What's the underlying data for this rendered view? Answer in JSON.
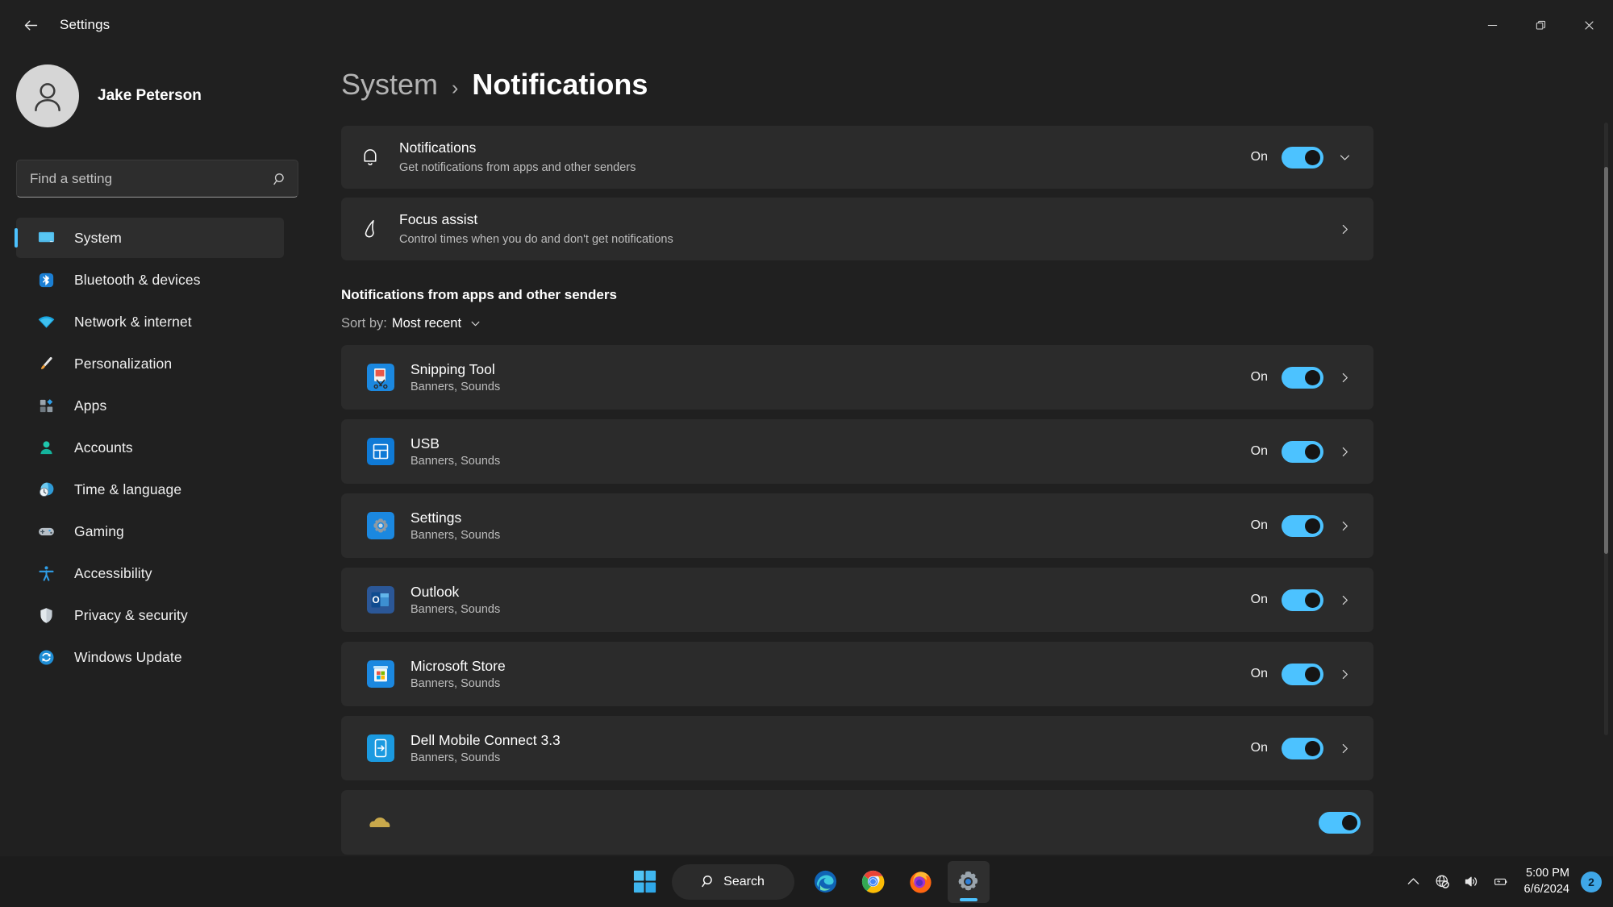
{
  "window": {
    "title": "Settings",
    "back_icon": "back-arrow-icon",
    "minimize_label": "Minimize",
    "restore_label": "Restore",
    "close_label": "Close"
  },
  "sidebar": {
    "profile_name": "Jake Peterson",
    "avatar_icon": "person-avatar-icon",
    "search": {
      "placeholder": "Find a setting",
      "value": "",
      "icon": "search-icon"
    },
    "items": [
      {
        "label": "System",
        "icon": "monitor-icon",
        "active": true
      },
      {
        "label": "Bluetooth & devices",
        "icon": "bluetooth-icon",
        "active": false
      },
      {
        "label": "Network & internet",
        "icon": "wifi-icon",
        "active": false
      },
      {
        "label": "Personalization",
        "icon": "paintbrush-icon",
        "active": false
      },
      {
        "label": "Apps",
        "icon": "apps-grid-icon",
        "active": false
      },
      {
        "label": "Accounts",
        "icon": "person-icon",
        "active": false
      },
      {
        "label": "Time & language",
        "icon": "clock-globe-icon",
        "active": false
      },
      {
        "label": "Gaming",
        "icon": "gamepad-icon",
        "active": false
      },
      {
        "label": "Accessibility",
        "icon": "accessibility-person-icon",
        "active": false
      },
      {
        "label": "Privacy & security",
        "icon": "shield-icon",
        "active": false
      },
      {
        "label": "Windows Update",
        "icon": "update-refresh-icon",
        "active": false
      }
    ]
  },
  "main": {
    "breadcrumb": {
      "parent": "System",
      "separator": "›",
      "current": "Notifications"
    },
    "cards": [
      {
        "title": "Notifications",
        "subtitle": "Get notifications from apps and other senders",
        "icon": "bell-icon",
        "toggle_label": "On",
        "toggle_state": "on",
        "trailing_icon": "chevron-down-icon"
      },
      {
        "title": "Focus assist",
        "subtitle": "Control times when you do and don't get notifications",
        "icon": "moon-icon",
        "toggle_label": "",
        "toggle_state": "none",
        "trailing_icon": "chevron-right-icon"
      }
    ],
    "section_header": "Notifications from apps and other senders",
    "sort": {
      "label": "Sort by:",
      "value": "Most recent",
      "icon": "chevron-down-icon"
    },
    "apps": [
      {
        "name": "Snipping Tool",
        "modes": "Banners, Sounds",
        "icon": "snipping-tool-icon",
        "toggle_label": "On",
        "toggle_state": "on",
        "trailing_icon": "chevron-right-icon"
      },
      {
        "name": "USB",
        "modes": "Banners, Sounds",
        "icon": "usb-icon",
        "toggle_label": "On",
        "toggle_state": "on",
        "trailing_icon": "chevron-right-icon"
      },
      {
        "name": "Settings",
        "modes": "Banners, Sounds",
        "icon": "settings-gear-icon",
        "toggle_label": "On",
        "toggle_state": "on",
        "trailing_icon": "chevron-right-icon"
      },
      {
        "name": "Outlook",
        "modes": "Banners, Sounds",
        "icon": "outlook-icon",
        "toggle_label": "On",
        "toggle_state": "on",
        "trailing_icon": "chevron-right-icon"
      },
      {
        "name": "Microsoft Store",
        "modes": "Banners, Sounds",
        "icon": "microsoft-store-icon",
        "toggle_label": "On",
        "toggle_state": "on",
        "trailing_icon": "chevron-right-icon"
      },
      {
        "name": "Dell Mobile Connect 3.3",
        "modes": "Banners, Sounds",
        "icon": "dell-mobile-connect-icon",
        "toggle_label": "On",
        "toggle_state": "on",
        "trailing_icon": "chevron-right-icon"
      }
    ]
  },
  "taskbar": {
    "start_label": "Start",
    "search": {
      "placeholder": "Search",
      "icon": "search-icon"
    },
    "apps": [
      {
        "name": "Microsoft Edge",
        "icon": "edge-icon",
        "active": false
      },
      {
        "name": "Google Chrome",
        "icon": "chrome-icon",
        "active": false
      },
      {
        "name": "Mozilla Firefox",
        "icon": "firefox-icon",
        "active": false
      },
      {
        "name": "Settings",
        "icon": "settings-gear-icon",
        "active": true
      }
    ],
    "tray": {
      "overflow_icon": "chevron-up-icon",
      "network_icon": "globe-no-internet-icon",
      "volume_icon": "speaker-icon",
      "battery_icon": "battery-charging-icon",
      "time": "5:00 PM",
      "date": "6/6/2024",
      "notification_count": "2"
    }
  },
  "colors": {
    "accent": "#4cc2ff",
    "window_bg": "#202020",
    "card_bg": "#2b2b2b",
    "taskbar_bg": "#1c1c1c"
  }
}
